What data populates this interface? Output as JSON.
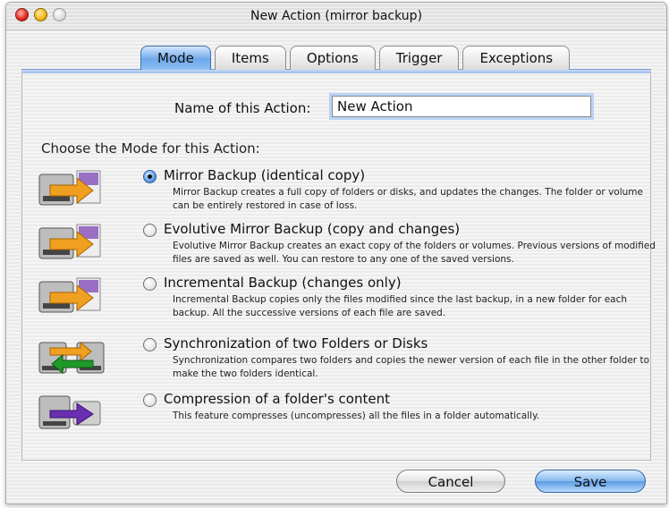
{
  "window": {
    "title": "New Action (mirror backup)"
  },
  "tabs": [
    {
      "label": "Mode",
      "active": true
    },
    {
      "label": "Items",
      "active": false
    },
    {
      "label": "Options",
      "active": false
    },
    {
      "label": "Trigger",
      "active": false
    },
    {
      "label": "Exceptions",
      "active": false
    }
  ],
  "form": {
    "name_label": "Name of this Action:",
    "name_value": "New Action",
    "choose_label": "Choose the Mode for this Action:"
  },
  "modes": [
    {
      "title": "Mirror Backup (identical copy)",
      "description": "Mirror Backup creates a full copy of folders or disks, and updates the changes. The folder or volume can be entirely restored in case of loss.",
      "selected": true,
      "icon": "mirror-backup-icon"
    },
    {
      "title": "Evolutive Mirror Backup (copy and changes)",
      "description": "Evolutive Mirror Backup creates an exact copy of the folders or volumes. Previous versions of modified files are saved as well. You can restore to any one of the saved versions.",
      "selected": false,
      "icon": "evolutive-backup-icon"
    },
    {
      "title": "Incremental Backup (changes only)",
      "description": "Incremental Backup copies only the files modified since the last backup, in a new folder for each backup. All the successive versions of each file are saved.",
      "selected": false,
      "icon": "incremental-backup-icon"
    },
    {
      "title": "Synchronization of two Folders or Disks",
      "description": "Synchronization compares two folders and copies the newer version of each file in the other folder to make the two folders identical.",
      "selected": false,
      "icon": "synchronization-icon"
    },
    {
      "title": "Compression of a folder's content",
      "description": "This feature compresses (uncompresses) all the files in a folder automatically.",
      "selected": false,
      "icon": "compression-icon"
    }
  ],
  "buttons": {
    "cancel": "Cancel",
    "save": "Save"
  },
  "colors": {
    "accent": "#6ea9ea",
    "arrow_orange": "#f0a020",
    "arrow_green": "#1f9a2a",
    "arrow_purple": "#6a2fb0"
  }
}
